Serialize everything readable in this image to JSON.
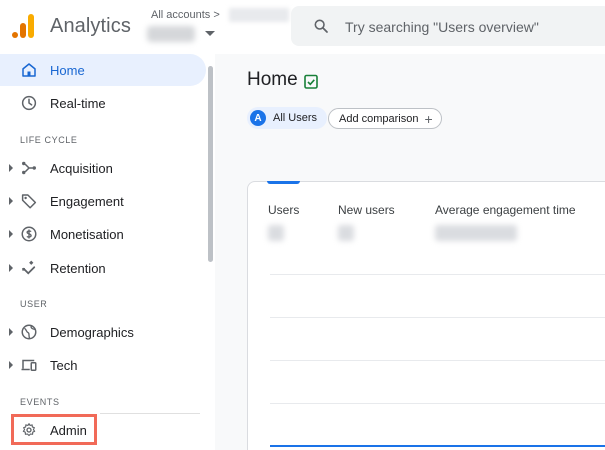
{
  "header": {
    "app_title": "Analytics",
    "accounts_label": "All accounts",
    "accounts_separator": ">",
    "search_placeholder": "Try searching \"Users overview\""
  },
  "sidebar": {
    "items": [
      {
        "label": "Home",
        "icon": "home-icon",
        "active": true
      },
      {
        "label": "Real-time",
        "icon": "clock-icon"
      }
    ],
    "sections": [
      {
        "title": "LIFE CYCLE",
        "items": [
          {
            "label": "Acquisition",
            "icon": "acquisition-icon"
          },
          {
            "label": "Engagement",
            "icon": "tag-icon"
          },
          {
            "label": "Monetisation",
            "icon": "dollar-icon"
          },
          {
            "label": "Retention",
            "icon": "magnet-icon"
          }
        ]
      },
      {
        "title": "USER",
        "items": [
          {
            "label": "Demographics",
            "icon": "globe-icon"
          },
          {
            "label": "Tech",
            "icon": "devices-icon"
          }
        ]
      },
      {
        "title": "EVENTS",
        "items": []
      }
    ],
    "admin": {
      "label": "Admin",
      "icon": "gear-icon"
    }
  },
  "main": {
    "title": "Home",
    "comparison_chip": {
      "avatar_letter": "A",
      "label": "All Users"
    },
    "add_comparison_label": "Add comparison",
    "metrics": [
      {
        "name": "Users"
      },
      {
        "name": "New users"
      },
      {
        "name": "Average engagement time"
      }
    ]
  },
  "colors": {
    "accent": "#1a73e8",
    "active_bg": "#e8f0fe",
    "highlight_border": "#f16a58",
    "logo_orange": "#e37400",
    "logo_yellow": "#f9ab00"
  }
}
